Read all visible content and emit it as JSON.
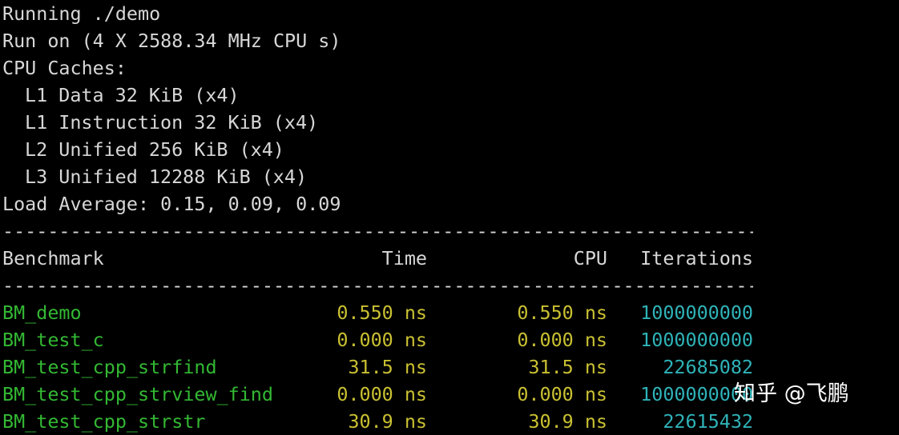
{
  "colors": {
    "background": "#000000",
    "text": "#d7d7d7",
    "benchmark_name": "#33b833",
    "timing_value": "#c9c032",
    "iterations": "#2fb3b8",
    "watermark": "#ffffff"
  },
  "header": {
    "running": "Running ./demo",
    "run_on": "Run on (4 X 2588.34 MHz CPU s)",
    "caches_title": "CPU Caches:",
    "caches": [
      "L1 Data 32 KiB (x4)",
      "L1 Instruction 32 KiB (x4)",
      "L2 Unified 256 KiB (x4)",
      "L3 Unified 12288 KiB (x4)"
    ],
    "load_average": "Load Average: 0.15, 0.09, 0.09"
  },
  "separator": "-----------------------------------------------------------------------------------------",
  "table": {
    "columns": [
      "Benchmark",
      "Time",
      "CPU",
      "Iterations"
    ],
    "rows": [
      {
        "name": "BM_demo",
        "time": "0.550 ns",
        "cpu": "0.550 ns",
        "iterations": "1000000000"
      },
      {
        "name": "BM_test_c",
        "time": "0.000 ns",
        "cpu": "0.000 ns",
        "iterations": "1000000000"
      },
      {
        "name": "BM_test_cpp_strfind",
        "time": "31.5 ns",
        "cpu": "31.5 ns",
        "iterations": "22685082"
      },
      {
        "name": "BM_test_cpp_strview_find",
        "time": "0.000 ns",
        "cpu": "0.000 ns",
        "iterations": "1000000000"
      },
      {
        "name": "BM_test_cpp_strstr",
        "time": "30.9 ns",
        "cpu": "30.9 ns",
        "iterations": "22615432"
      }
    ]
  },
  "watermark": "知乎 @飞鹏"
}
